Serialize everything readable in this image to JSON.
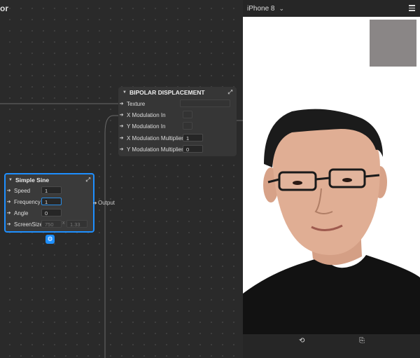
{
  "editor": {
    "title": "or"
  },
  "bipolar_node": {
    "title": "BIPOLAR DISPLACEMENT",
    "rows": [
      {
        "label": "Texture",
        "value": ""
      },
      {
        "label": "X Modulation  In",
        "value": ""
      },
      {
        "label": "Y Modulation In",
        "value": ""
      },
      {
        "label": "X Modulation Multiplier",
        "value": "1"
      },
      {
        "label": "Y Modulation Multiplier",
        "value": "0"
      }
    ]
  },
  "simple_sine_node": {
    "title": "Simple Sine",
    "speed": {
      "label": "Speed",
      "value": "1"
    },
    "frequency": {
      "label": "Frequency",
      "value": "1"
    },
    "angle": {
      "label": "Angle",
      "value": "0"
    },
    "screen_size": {
      "label": "ScreenSize",
      "width": "750",
      "x_label": "x",
      "height": "1.33"
    },
    "output_label": "Output"
  },
  "icons": {
    "port": "arrow-right-icon",
    "expand": "expand-icon",
    "settings": "gear-icon",
    "menu": "hamburger-icon",
    "rotate": "rotate-icon",
    "flip": "flip-icon"
  },
  "preview": {
    "device": "iPhone 8",
    "image": "portrait-photo-of-young-man-with-glasses-black-tshirt",
    "thumbnail_color": "#8a8686"
  },
  "colors": {
    "accent": "#1e8fff",
    "node_bg": "#3a3a3a",
    "canvas_bg": "#2a2a2a"
  }
}
